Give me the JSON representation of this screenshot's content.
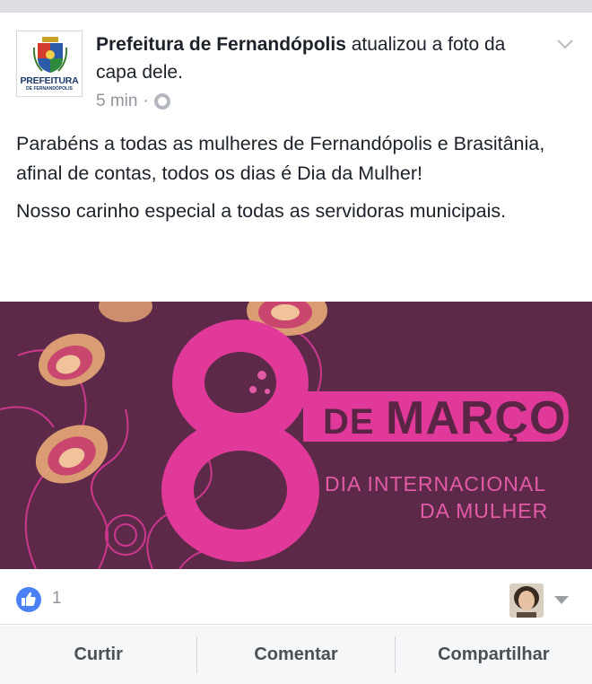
{
  "post": {
    "page_name": "Prefeitura de Fernandópolis",
    "action_text": " atualizou a foto da capa dele.",
    "timestamp": "5 min",
    "separator": "·",
    "avatar": {
      "line1": "PREFEITURA",
      "line2": "DE FERNANDÓPOLIS"
    },
    "paragraphs": [
      "Parabéns a todas as mulheres de Fernandópolis e Brasitânia, afinal de contas, todos os dias é Dia da Mulher!",
      "Nosso carinho especial a todas as servidoras municipais."
    ],
    "cover_image": {
      "big_number": "8",
      "de": "DE",
      "marco": "MARÇO",
      "line1": "DIA INTERNACIONAL",
      "line2": "DA MULHER",
      "colors": {
        "background": "#5c2a48",
        "accent": "#e0399a",
        "peach": "#e8a878"
      }
    }
  },
  "reactions": {
    "like_count": "1",
    "icon": "thumbs-up-icon"
  },
  "actions": {
    "like_label": "Curtir",
    "comment_label": "Comentar",
    "share_label": "Compartilhar"
  },
  "colors": {
    "like_blue": "#4a80f5",
    "meta_gray": "#90949c",
    "text": "#1d2129"
  }
}
